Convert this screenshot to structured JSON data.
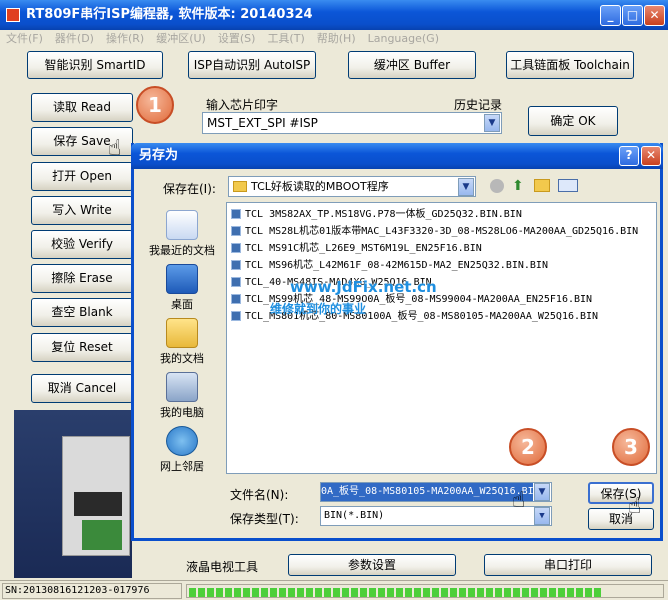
{
  "window": {
    "title": "RT809F串行ISP编程器, 软件版本: 20140324",
    "minimize": "_",
    "maximize": "□",
    "close": "✕"
  },
  "menu": [
    "文件(F)",
    "器件(D)",
    "操作(R)",
    "缓冲区(U)",
    "设置(S)",
    "工具(T)",
    "帮助(H)",
    "Language(G)"
  ],
  "toolbar": {
    "smart_id": "智能识别 SmartID",
    "auto_isp": "ISP自动识别 AutoISP",
    "buffer": "缓冲区 Buffer",
    "toolchain": "工具链面板 Toolchain"
  },
  "actions": {
    "read": "读取 Read",
    "save": "保存 Save",
    "open": "打开 Open",
    "write": "写入 Write",
    "verify": "校验 Verify",
    "erase": "擦除 Erase",
    "blank": "查空 Blank",
    "reset": "复位 Reset",
    "cancel": "取消 Cancel"
  },
  "chip": {
    "label": "输入芯片印字",
    "history_label": "历史记录",
    "value": "MST_EXT_SPI #ISP",
    "ok": "确定 OK"
  },
  "bottom": {
    "lcd_tools": "液晶电视工具",
    "params": "参数设置",
    "serial_print": "串口打印"
  },
  "status": {
    "sn": "SN:20130816121203-017976",
    "progress_segments": 46
  },
  "dialog": {
    "title": "另存为",
    "help": "?",
    "close": "✕",
    "save_in_label": "保存在(I):",
    "folder": "TCL好板读取的MBOOT程序",
    "places": [
      "我最近的文档",
      "桌面",
      "我的文档",
      "我的电脑",
      "网上邻居"
    ],
    "files": [
      "TCL 3MS82AX_TP.MS18VG.P78一体板_GD25Q32.BIN.BIN",
      "TCL MS28L机芯01版本带MAC_L43F3320-3D_08-MS28LO6-MA200AA_GD25Q16.BIN",
      "TCL MS91C机芯_L26E9_MST6M19L_EN25F16.BIN",
      "TCL MS96机芯_L42M61F_08-42M615D-MA2_EN25Q32.BIN.BIN",
      "TCL_40-MS48IS-MAD4XG_W25Q16.BIN",
      "TCL_MS99机芯_48-MS99O0A_板号_08-MS99004-MA200AA_EN25F16.BIN",
      "TCL_MS801机芯_80-MS80100A_板号_08-MS80105-MA200AA_W25Q16.BIN"
    ],
    "watermark": "www.JdFix.net.cn",
    "watermark2": "维修就到你的事业",
    "filename_label": "文件名(N):",
    "filename_value": "0A_板号_08-MS80105-MA200AA_W25Q16.BIN",
    "filetype_label": "保存类型(T):",
    "filetype_value": "BIN(*.BIN)",
    "save": "保存(S)",
    "cancel": "取消"
  },
  "callouts": [
    "1",
    "2",
    "3"
  ],
  "colors": {
    "titlebar": "#0A4FCC",
    "callout": "#E06A3A",
    "progress": "#4CCF3A"
  }
}
